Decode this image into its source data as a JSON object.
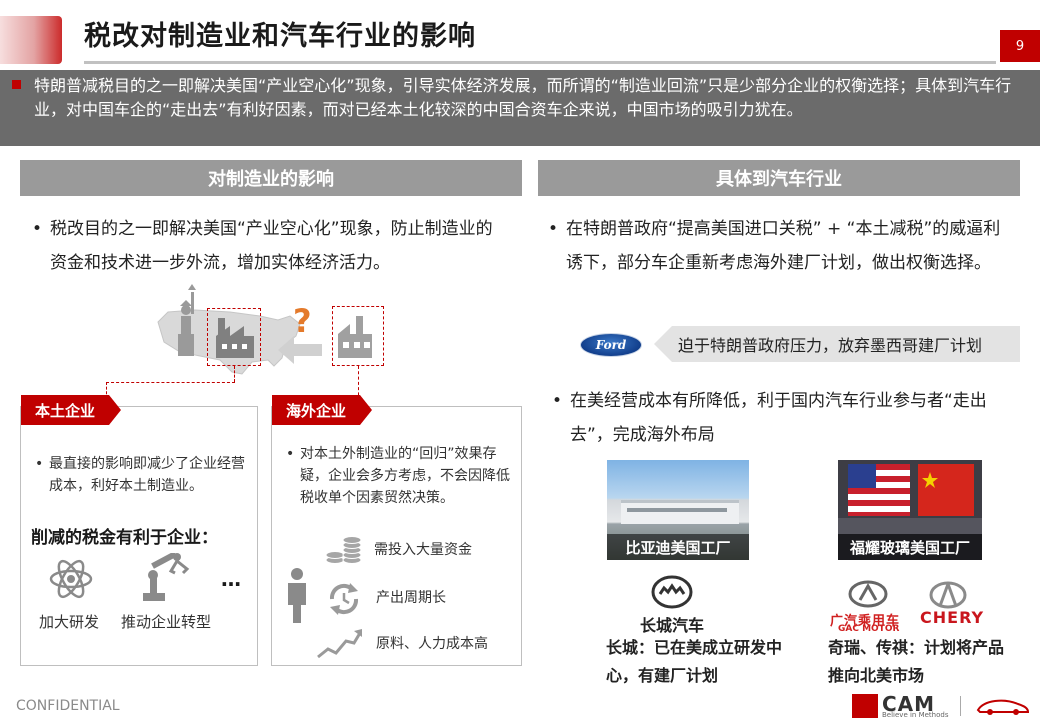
{
  "header": {
    "title": "税改对制造业和汽车行业的影响",
    "page_number": "9"
  },
  "summary": {
    "text": "特朗普减税目的之一即解决美国“产业空心化”现象，引导实体经济发展，而所谓的“制造业回流”只是少部分企业的权衡选择；具体到汽车行业，对中国车企的“走出去”有利好因素，而对已经本土化较深的中国合资车企来说，中国市场的吸引力犹在。"
  },
  "left": {
    "heading": "对制造业的影响",
    "bullet": "税改目的之一即解决美国“产业空心化”现象，防止制造业的资金和技术进一步外流，增加实体经济活力。",
    "domestic": {
      "tag": "本土企业",
      "bullet": "最直接的影响即减少了企业经营成本，利好本土制造业。",
      "subheading": "削减的税金有利于企业：",
      "items": [
        "加大研发",
        "推动企业转型"
      ],
      "ellipsis": "…"
    },
    "overseas": {
      "tag": "海外企业",
      "bullet": "对本土外制造业的“回归”效果存疑，企业会多方考虑，不会因降低税收单个因素贸然决策。",
      "factors": [
        "需投入大量资金",
        "产出周期长",
        "原料、人力成本高"
      ]
    },
    "question_mark": "?"
  },
  "right": {
    "heading": "具体到汽车行业",
    "bullet1": "在特朗普政府“提高美国进口关税” + “本土减税”的威逼利诱下，部分车企重新考虑海外建厂计划，做出权衡选择。",
    "ford_logo": "Ford",
    "ford_note": "迫于特朗普政府压力，放弃墨西哥建厂计划",
    "bullet2": "在美经营成本有所降低，利于国内汽车行业参与者“走出去”，完成海外布局",
    "photos": [
      {
        "caption": "比亚迪美国工厂"
      },
      {
        "caption": "福耀玻璃美国工厂"
      }
    ],
    "great_wall": {
      "logo_text": "长城汽车",
      "note": "长城：已在美成立研发中心，有建厂计划"
    },
    "others": {
      "gac_logo": "广汽乘用车",
      "gac_sub": "GAC MOTOR",
      "chery_logo": "CHERY",
      "note": "奇瑞、传祺：计划将产品推向北美市场"
    }
  },
  "footer": {
    "confidential": "CONFIDENTIAL",
    "cam_logo": "CAM",
    "cam_tagline": "Believe in Methods"
  }
}
